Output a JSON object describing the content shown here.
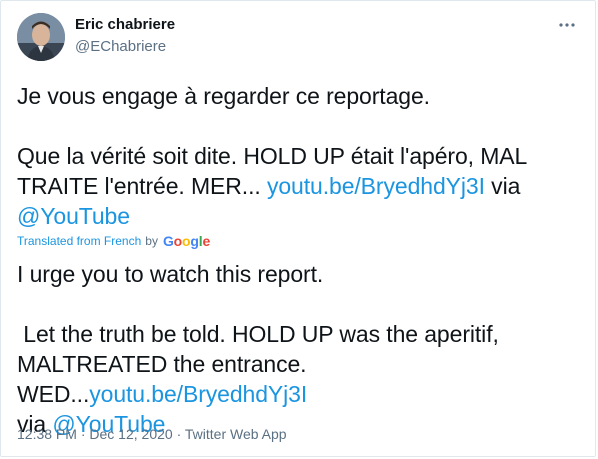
{
  "author": {
    "name": "Eric chabriere",
    "handle": "@EChabriere"
  },
  "original": {
    "line1": "Je vous engage à regarder ce reportage.",
    "line2_text": "Que la vérité soit dite. HOLD UP était l'apéro, MAL TRAITE l'entrée. MER... ",
    "line2_link": "youtu.be/BryedhdYj3I",
    "line2_via": " via",
    "mention": "@YouTube"
  },
  "translation": {
    "label": "Translated from French",
    "by": "by",
    "provider": "Google",
    "line1": "I urge you to watch this report.",
    "line2_text": " Let the truth be told. HOLD UP was the aperitif, MALTREATED the entrance. WED...",
    "line2_link": "youtu.be/BryedhdYj3I",
    "line2_via": "via ",
    "mention": "@YouTube"
  },
  "meta": {
    "time": "12:38 PM",
    "separator": " · ",
    "date": "Dec 12, 2020",
    "source": "Twitter Web App"
  },
  "colors": {
    "link": "#1b95e0",
    "secondary": "#5b7083",
    "text": "#0f1419",
    "border": "#e1e8ed"
  },
  "icons": {
    "more": "more-horizontal-icon"
  }
}
